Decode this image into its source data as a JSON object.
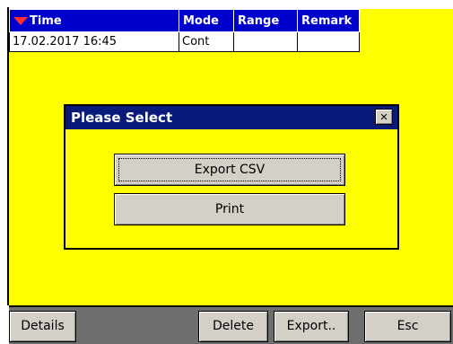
{
  "table": {
    "headers": {
      "time": "Time",
      "mode": "Mode",
      "range": "Range",
      "remark": "Remark"
    },
    "rows": [
      {
        "time": "17.02.2017 16:45",
        "mode": "Cont",
        "range": "",
        "remark": ""
      }
    ],
    "header_color": "#0000cc"
  },
  "dialog": {
    "title": "Please Select",
    "close_label": "×",
    "export_csv_label": "Export CSV",
    "print_label": "Print"
  },
  "toolbar": {
    "details_label": "Details",
    "delete_label": "Delete",
    "export_label": "Export..",
    "esc_label": "Esc"
  },
  "colors": {
    "background": "#ffff00",
    "title_bar": "#0a1a7a",
    "sort_icon": "#ff3030"
  },
  "icons": {
    "sort": "sort-down-arrow-icon",
    "close": "close-icon"
  }
}
